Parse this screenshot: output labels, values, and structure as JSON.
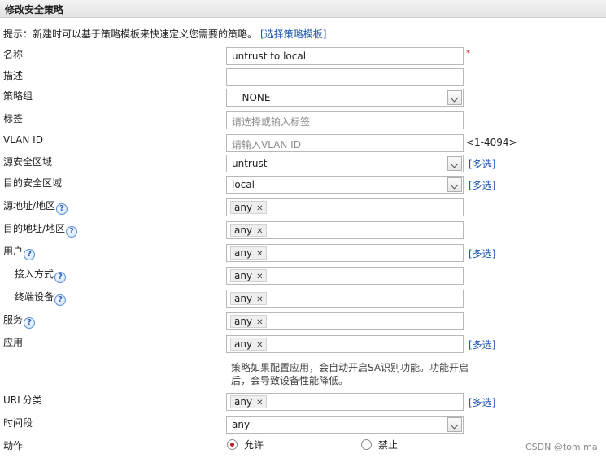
{
  "title": "修改安全策略",
  "tip": {
    "text": "提示：新建时可以基于策略模板来快速定义您需要的策略。",
    "link": "[选择策略模板]"
  },
  "help_symbol": "?",
  "tag_remove": "✕",
  "fields": {
    "name": {
      "label": "名称",
      "value": "untrust to local"
    },
    "desc": {
      "label": "描述",
      "value": ""
    },
    "group": {
      "label": "策略组",
      "value": "-- NONE --"
    },
    "tag": {
      "label": "标签",
      "placeholder": "请选择或输入标签"
    },
    "vlan": {
      "label": "VLAN ID",
      "placeholder": "请输入VLAN ID",
      "hint": "<1-4094>"
    },
    "src_zone": {
      "label": "源安全区域",
      "value": "untrust",
      "multi": "[多选]"
    },
    "dst_zone": {
      "label": "目的安全区域",
      "value": "local",
      "multi": "[多选]"
    },
    "src_addr": {
      "label": "源地址/地区",
      "tag": "any"
    },
    "dst_addr": {
      "label": "目的地址/地区",
      "tag": "any"
    },
    "user": {
      "label": "用户",
      "tag": "any",
      "multi": "[多选]"
    },
    "access": {
      "label": "接入方式",
      "tag": "any"
    },
    "terminal": {
      "label": "终端设备",
      "tag": "any"
    },
    "service": {
      "label": "服务",
      "tag": "any"
    },
    "app": {
      "label": "应用",
      "tag": "any",
      "multi": "[多选]",
      "note": "策略如果配置应用，会自动开启SA识别功能。功能开启后，会导致设备性能降低。"
    },
    "url": {
      "label": "URL分类",
      "tag": "any",
      "multi": "[多选]"
    },
    "time": {
      "label": "时间段",
      "value": "any"
    },
    "action": {
      "label": "动作",
      "options": [
        "允许",
        "禁止"
      ],
      "selected": "允许"
    }
  },
  "required_mark": "*",
  "watermark": "CSDN @tom.ma"
}
